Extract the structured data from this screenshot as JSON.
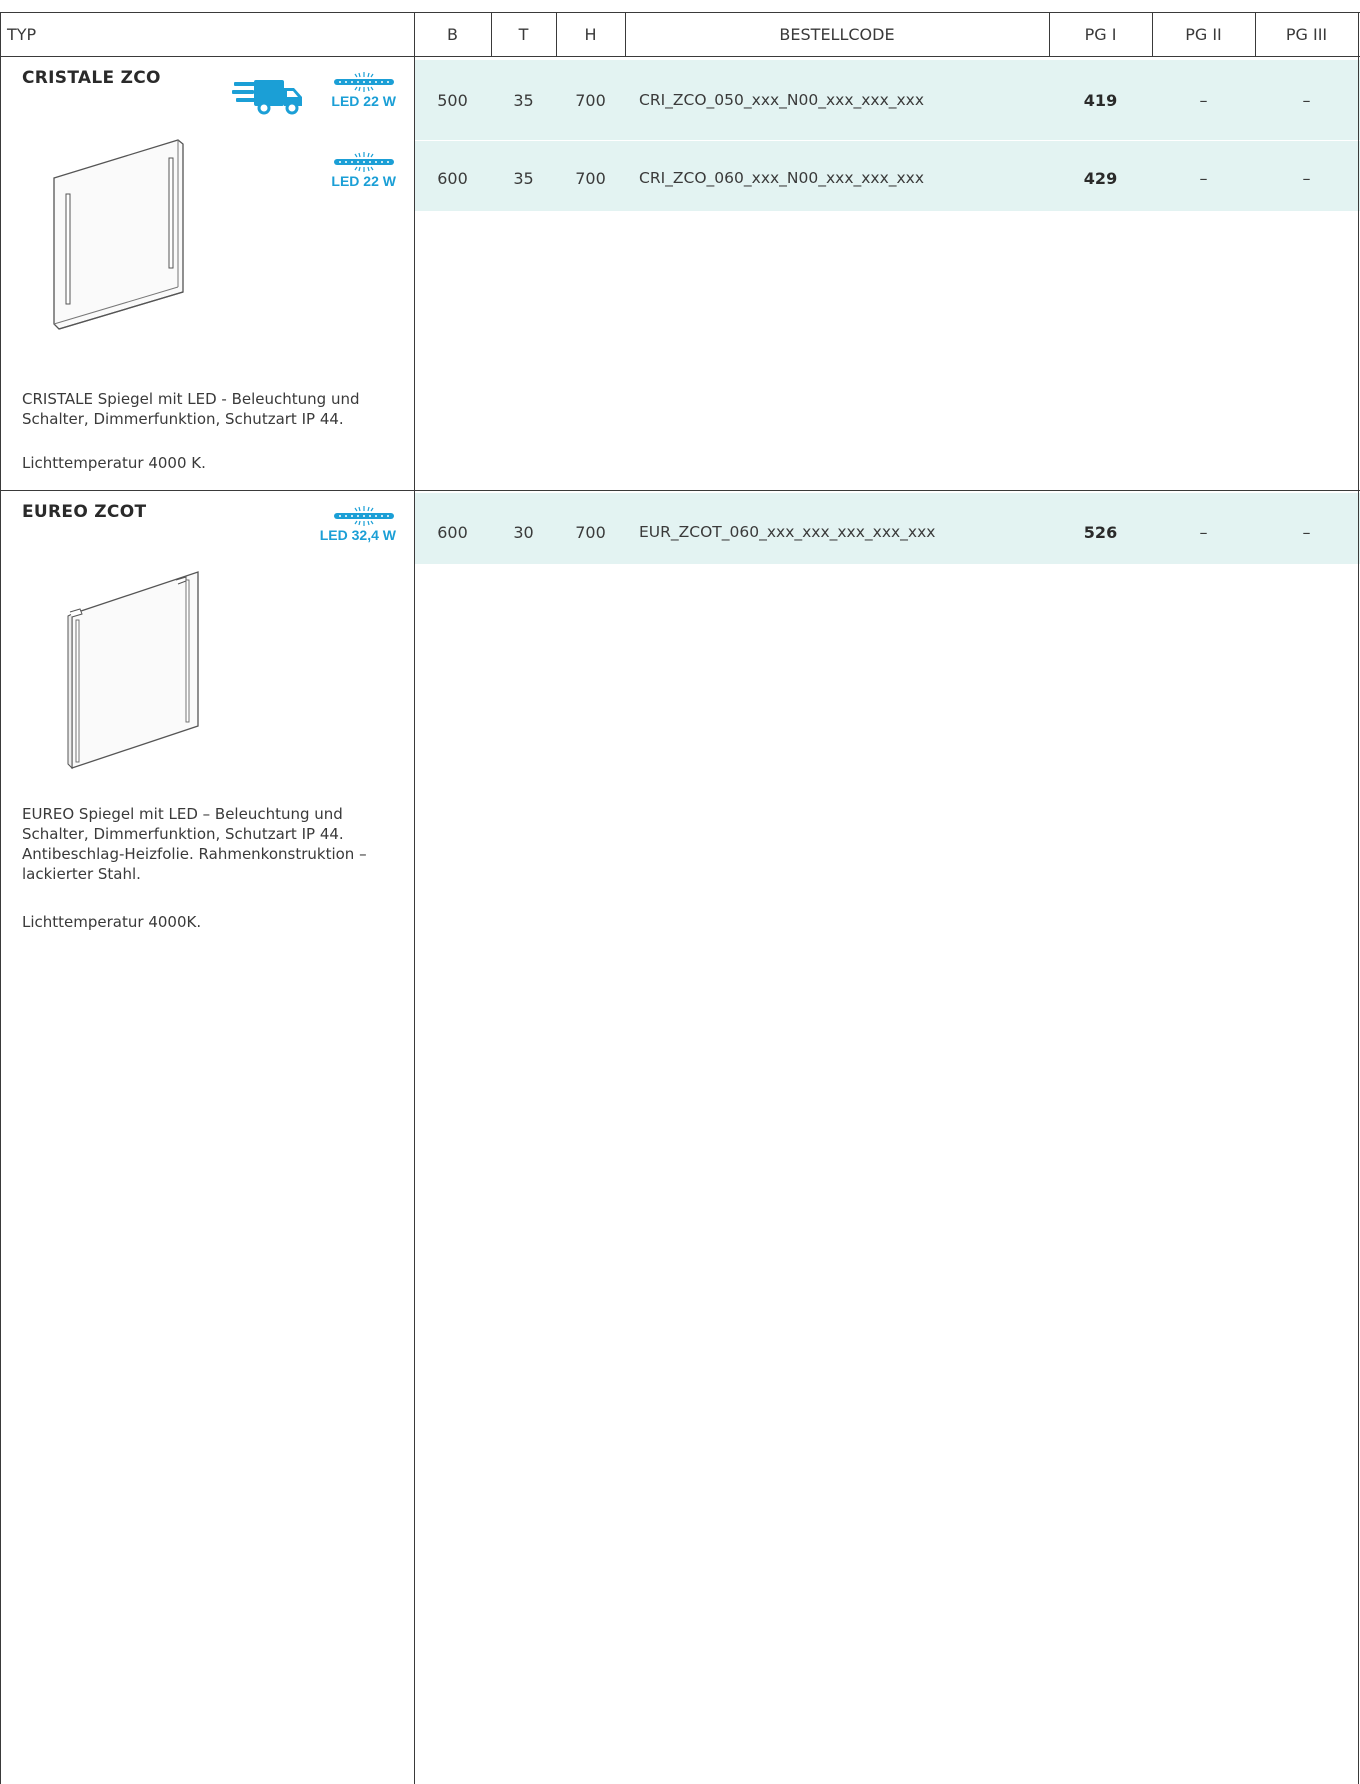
{
  "colors": {
    "accent": "#1b9fd6",
    "row_bg": "#e3f3f2",
    "line": "#3a3a3a"
  },
  "columns": {
    "typ": "TYP",
    "b": "B",
    "t": "T",
    "h": "H",
    "code": "BESTELLCODE",
    "pg1": "PG I",
    "pg2": "PG II",
    "pg3": "PG III"
  },
  "products": [
    {
      "name": "CRISTALE ZCO",
      "icons": [
        "delivery-truck-icon",
        "led-strip-icon"
      ],
      "led_labels": [
        "LED 22 W",
        "LED 22 W"
      ],
      "description": "CRISTALE Spiegel mit LED - Beleuchtung und Schalter, Dimmerfunktion, Schutzart IP 44.",
      "light_temp": "Lichttemperatur  4000 K.",
      "rows": [
        {
          "b": "500",
          "t": "35",
          "h": "700",
          "code": "CRI_ZCO_050_xxx_N00_xxx_xxx_xxx",
          "pg1": "419",
          "pg2": "–",
          "pg3": "–"
        },
        {
          "b": "600",
          "t": "35",
          "h": "700",
          "code": "CRI_ZCO_060_xxx_N00_xxx_xxx_xxx",
          "pg1": "429",
          "pg2": "–",
          "pg3": "–"
        }
      ]
    },
    {
      "name": "EUREO ZCOT",
      "icons": [
        "led-strip-icon"
      ],
      "led_labels": [
        "LED 32,4 W"
      ],
      "description": "EUREO Spiegel mit LED – Beleuchtung und Schalter, Dimmerfunktion, Schutzart IP 44. Antibeschlag-Heizfolie. Rahmenkonstruktion – lackierter Stahl.",
      "light_temp": "Lichttemperatur  4000K.",
      "rows": [
        {
          "b": "600",
          "t": "30",
          "h": "700",
          "code": "EUR_ZCOT_060_xxx_xxx_xxx_xxx_xxx",
          "pg1": "526",
          "pg2": "–",
          "pg3": "–"
        }
      ]
    }
  ]
}
